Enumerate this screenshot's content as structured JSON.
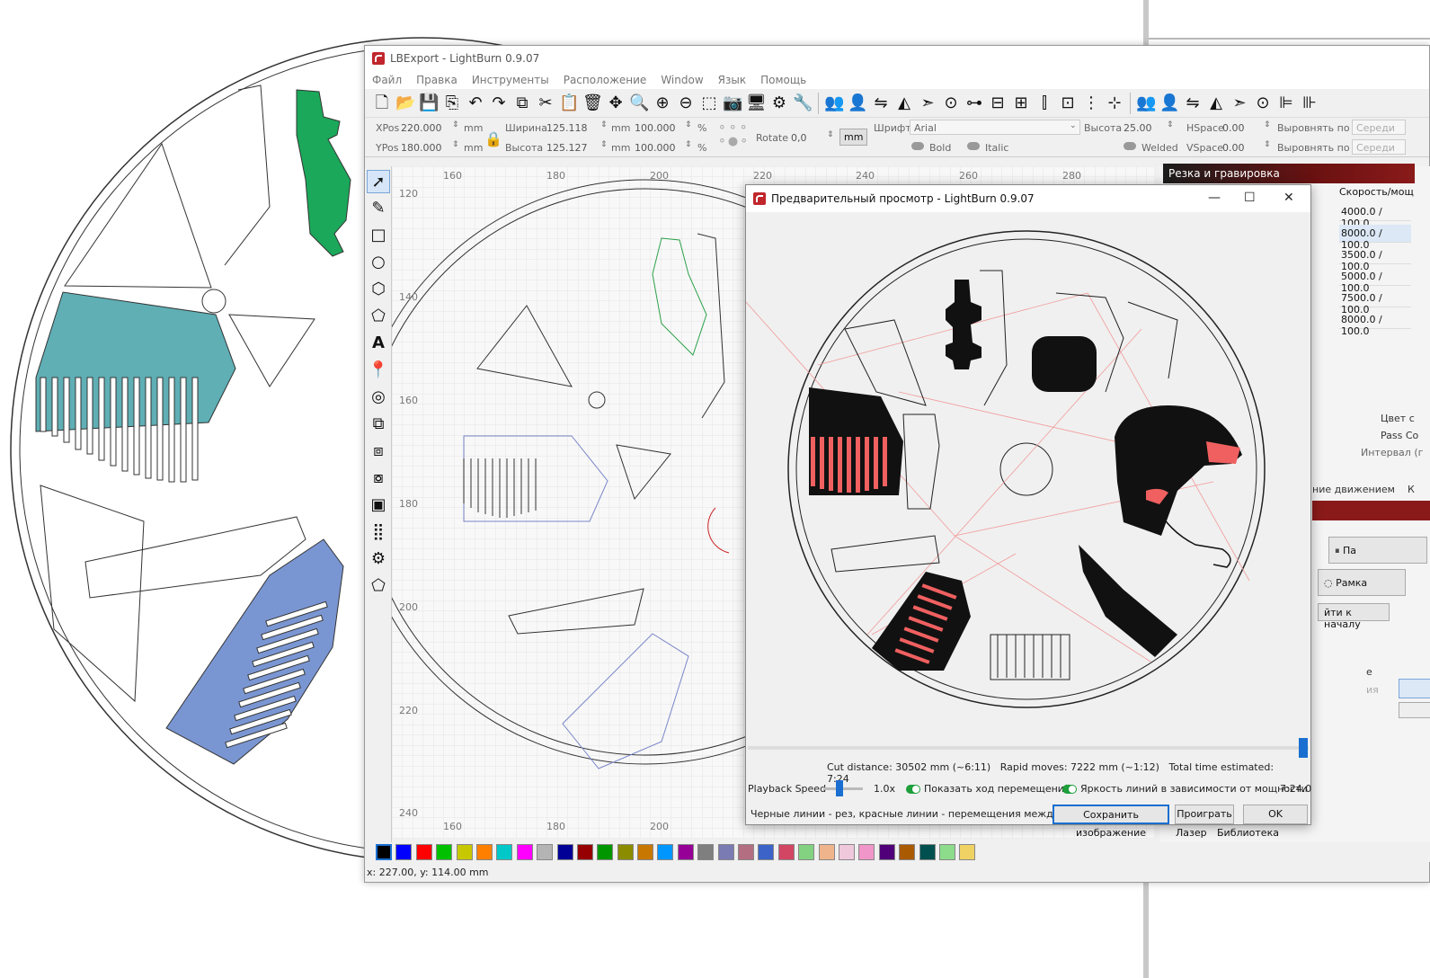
{
  "main_window": {
    "title": "LBExport - LightBurn 0.9.07",
    "menu": [
      "Файл",
      "Правка",
      "Инструменты",
      "Расположение",
      "Window",
      "Язык",
      "Помощь"
    ]
  },
  "props": {
    "xpos_label": "XPos",
    "xpos": "220.000",
    "ypos_label": "YPos",
    "ypos": "180.000",
    "unit": "mm",
    "width_label": "Ширина",
    "width": "125.118",
    "height_label": "Высота",
    "height": "125.127",
    "scale_x": "100.000",
    "scale_y": "100.000",
    "percent": "%",
    "rotate_label": "Rotate",
    "rotate": "0,0",
    "mm_button": "mm",
    "font_label": "Шрифт",
    "font_value": "Arial",
    "font_height_label": "Высота",
    "font_height": "25.00",
    "bold": "Bold",
    "italic": "Italic",
    "welded": "Welded",
    "hspace_label": "HSpace",
    "hspace": "0.00",
    "vspace_label": "VSpace",
    "vspace": "0.00",
    "align_x": "Выровнять по X",
    "align_y": "Выровнять по Y",
    "align_val": "Середи"
  },
  "ruler": {
    "top": [
      "160",
      "180",
      "200",
      "220",
      "240",
      "260",
      "280"
    ],
    "left": [
      "120",
      "140",
      "160",
      "180",
      "200",
      "220",
      "240"
    ],
    "bottom": [
      "160",
      "180",
      "200"
    ]
  },
  "right_panel": {
    "header": "Резка и гравировка",
    "speed_header": "Скорость/мощ",
    "speeds": [
      "4000.0 / 100.0",
      "8000.0 / 100.0",
      "3500.0 / 100.0",
      "5000.0 / 100.0",
      "7500.0 / 100.0",
      "8000.0 / 100.0"
    ],
    "color_label": "Цвет с",
    "pass_label": "Pass Co",
    "interval_label": "Интервал (г",
    "move_tab": "ние движением",
    "k_tab": "К",
    "pause_btn": "Па",
    "frame_btn": "Рамка",
    "home_btn": "йти к началу",
    "e_label": "е",
    "iya_label": "ия",
    "laser_tab": "Лазер",
    "library_tab": "Библиотека",
    "n280": "280"
  },
  "preview": {
    "title": "Предварительный просмотр - LightBurn 0.9.07",
    "cut_distance": "Cut distance: 30502 mm (~6:11)",
    "rapid_moves": "Rapid moves: 7222 mm (~1:12)",
    "total_time": "Total time estimated: 7:24",
    "playback_label": "Playback Speed",
    "playback_value": "1.0x",
    "show_moves": "Показать ход перемещений",
    "brightness": "Яркость линий в зависимости от мощности",
    "time_readout": "7:24.0",
    "legend": "Черные линии - рез, красные линии - перемещения между резами",
    "save_btn": "Сохранить изображение",
    "play_btn": "Проиграть",
    "ok_btn": "OK"
  },
  "palette": [
    "#000000",
    "#0000ff",
    "#ff0000",
    "#00c000",
    "#c8c800",
    "#ff8000",
    "#00c8c8",
    "#ff00ff",
    "#b4b4b4",
    "#000096",
    "#960000",
    "#009600",
    "#8c8c00",
    "#c87800",
    "#0096ff",
    "#960096",
    "#7f7f7f",
    "#7b7bb4",
    "#b46e82",
    "#3c64c8",
    "#d24664",
    "#82d282",
    "#f0b48c",
    "#f0c8dc",
    "#f096c8",
    "#500078",
    "#aa5a00",
    "#005050",
    "#8cdc8c",
    "#f0d264"
  ],
  "status": "x: 227.00, y: 114.00 mm"
}
